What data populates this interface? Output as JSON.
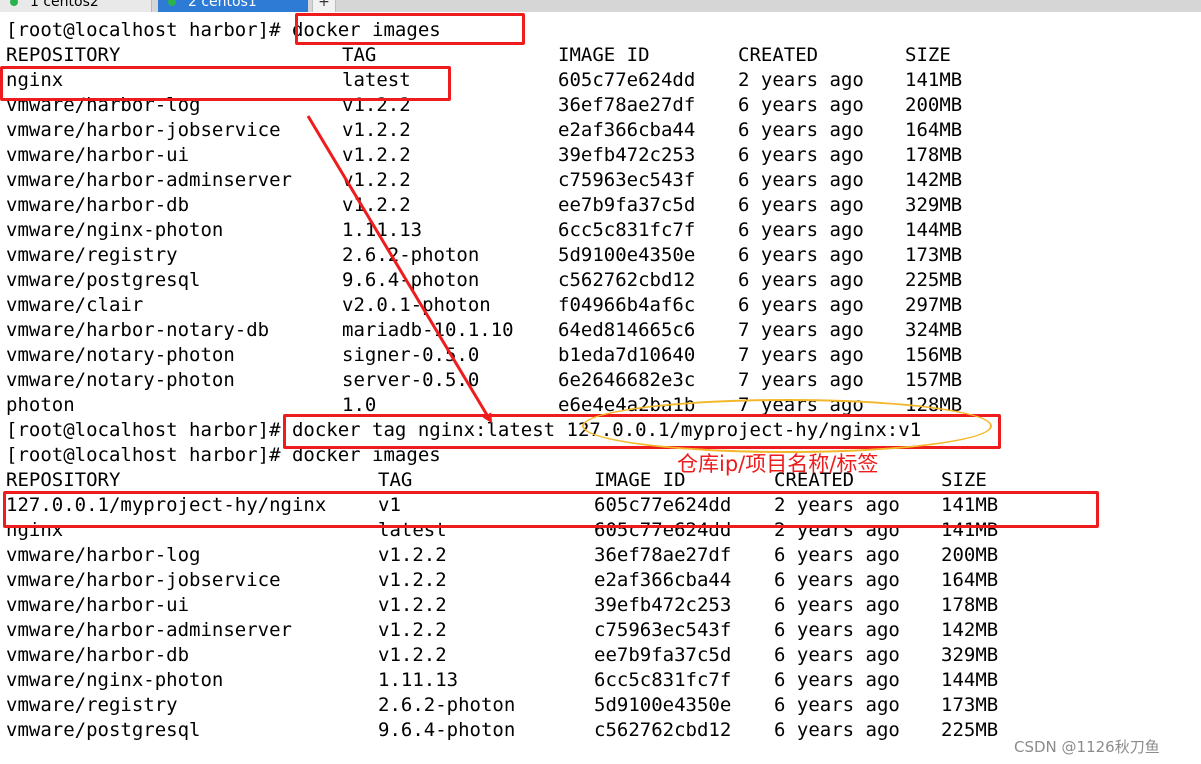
{
  "tabs": [
    {
      "label": "1 centos2",
      "active": false
    },
    {
      "label": "2 centos1",
      "active": true
    }
  ],
  "add_tab_label": "+",
  "prompt": "[root@localhost harbor]# ",
  "commands": {
    "images": "docker images",
    "tag": "docker tag nginx:latest 127.0.0.1/myproject-hy/nginx:v1"
  },
  "headers": [
    "REPOSITORY",
    "TAG",
    "IMAGE ID",
    "CREATED",
    "SIZE"
  ],
  "first_listing": [
    {
      "repo": "nginx",
      "tag": "latest",
      "id": "605c77e624dd",
      "created": "2 years ago",
      "size": "141MB"
    },
    {
      "repo": "vmware/harbor-log",
      "tag": "v1.2.2",
      "id": "36ef78ae27df",
      "created": "6 years ago",
      "size": "200MB"
    },
    {
      "repo": "vmware/harbor-jobservice",
      "tag": "v1.2.2",
      "id": "e2af366cba44",
      "created": "6 years ago",
      "size": "164MB"
    },
    {
      "repo": "vmware/harbor-ui",
      "tag": "v1.2.2",
      "id": "39efb472c253",
      "created": "6 years ago",
      "size": "178MB"
    },
    {
      "repo": "vmware/harbor-adminserver",
      "tag": "v1.2.2",
      "id": "c75963ec543f",
      "created": "6 years ago",
      "size": "142MB"
    },
    {
      "repo": "vmware/harbor-db",
      "tag": "v1.2.2",
      "id": "ee7b9fa37c5d",
      "created": "6 years ago",
      "size": "329MB"
    },
    {
      "repo": "vmware/nginx-photon",
      "tag": "1.11.13",
      "id": "6cc5c831fc7f",
      "created": "6 years ago",
      "size": "144MB"
    },
    {
      "repo": "vmware/registry",
      "tag": "2.6.2-photon",
      "id": "5d9100e4350e",
      "created": "6 years ago",
      "size": "173MB"
    },
    {
      "repo": "vmware/postgresql",
      "tag": "9.6.4-photon",
      "id": "c562762cbd12",
      "created": "6 years ago",
      "size": "225MB"
    },
    {
      "repo": "vmware/clair",
      "tag": "v2.0.1-photon",
      "id": "f04966b4af6c",
      "created": "6 years ago",
      "size": "297MB"
    },
    {
      "repo": "vmware/harbor-notary-db",
      "tag": "mariadb-10.1.10",
      "id": "64ed814665c6",
      "created": "7 years ago",
      "size": "324MB"
    },
    {
      "repo": "vmware/notary-photon",
      "tag": "signer-0.5.0",
      "id": "b1eda7d10640",
      "created": "7 years ago",
      "size": "156MB"
    },
    {
      "repo": "vmware/notary-photon",
      "tag": "server-0.5.0",
      "id": "6e2646682e3c",
      "created": "7 years ago",
      "size": "157MB"
    },
    {
      "repo": "photon",
      "tag": "1.0",
      "id": "e6e4e4a2ba1b",
      "created": "7 years ago",
      "size": "128MB"
    }
  ],
  "second_listing": [
    {
      "repo": "127.0.0.1/myproject-hy/nginx",
      "tag": "v1",
      "id": "605c77e624dd",
      "created": "2 years ago",
      "size": "141MB"
    },
    {
      "repo": "nginx",
      "tag": "latest",
      "id": "605c77e624dd",
      "created": "2 years ago",
      "size": "141MB"
    },
    {
      "repo": "vmware/harbor-log",
      "tag": "v1.2.2",
      "id": "36ef78ae27df",
      "created": "6 years ago",
      "size": "200MB"
    },
    {
      "repo": "vmware/harbor-jobservice",
      "tag": "v1.2.2",
      "id": "e2af366cba44",
      "created": "6 years ago",
      "size": "164MB"
    },
    {
      "repo": "vmware/harbor-ui",
      "tag": "v1.2.2",
      "id": "39efb472c253",
      "created": "6 years ago",
      "size": "178MB"
    },
    {
      "repo": "vmware/harbor-adminserver",
      "tag": "v1.2.2",
      "id": "c75963ec543f",
      "created": "6 years ago",
      "size": "142MB"
    },
    {
      "repo": "vmware/harbor-db",
      "tag": "v1.2.2",
      "id": "ee7b9fa37c5d",
      "created": "6 years ago",
      "size": "329MB"
    },
    {
      "repo": "vmware/nginx-photon",
      "tag": "1.11.13",
      "id": "6cc5c831fc7f",
      "created": "6 years ago",
      "size": "144MB"
    },
    {
      "repo": "vmware/registry",
      "tag": "2.6.2-photon",
      "id": "5d9100e4350e",
      "created": "6 years ago",
      "size": "173MB"
    },
    {
      "repo": "vmware/postgresql",
      "tag": "9.6.4-photon",
      "id": "c562762cbd12",
      "created": "6 years ago",
      "size": "225MB"
    }
  ],
  "annotation_note": "仓库ip/项目名称/标签",
  "watermark": "CSDN @1126秋刀鱼",
  "colors": {
    "annotation": "#ee1c1c",
    "highlight_ellipse": "#f3b82a",
    "active_tab": "#2e7bd6",
    "session_dot": "#2ab34a"
  }
}
